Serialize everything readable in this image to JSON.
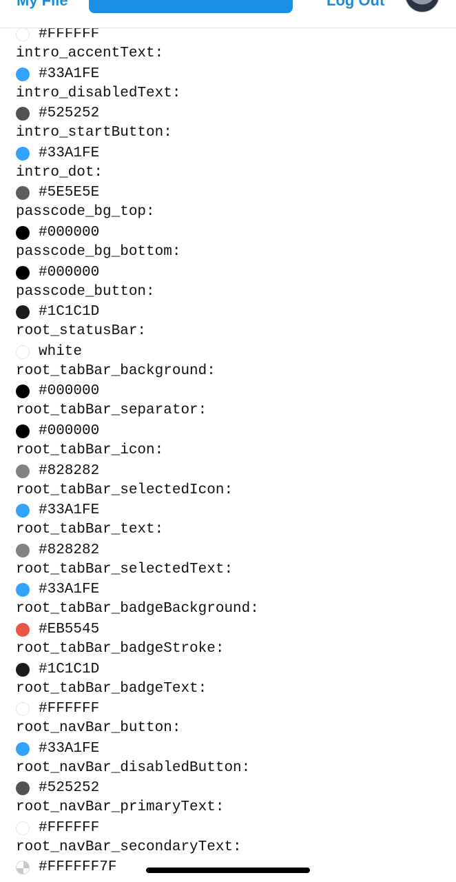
{
  "header": {
    "left_link": "My File",
    "right_link": "Log Out"
  },
  "colors": [
    {
      "value": "#FFFFFF",
      "swatch": "#FFFFFF",
      "next_name": "intro_accentText:"
    },
    {
      "value": "#33A1FE",
      "swatch": "#33A1FE",
      "next_name": "intro_disabledText:"
    },
    {
      "value": "#525252",
      "swatch": "#525252",
      "next_name": "intro_startButton:"
    },
    {
      "value": "#33A1FE",
      "swatch": "#33A1FE",
      "next_name": "intro_dot:"
    },
    {
      "value": "#5E5E5E",
      "swatch": "#5E5E5E",
      "next_name": "passcode_bg_top:"
    },
    {
      "value": "#000000",
      "swatch": "#000000",
      "next_name": "passcode_bg_bottom:"
    },
    {
      "value": "#000000",
      "swatch": "#000000",
      "next_name": "passcode_button:"
    },
    {
      "value": "#1C1C1D",
      "swatch": "#1C1C1D",
      "next_name": "root_statusBar:"
    },
    {
      "value": "white",
      "swatch": "#FFFFFF",
      "next_name": "root_tabBar_background:"
    },
    {
      "value": "#000000",
      "swatch": "#000000",
      "next_name": "root_tabBar_separator:"
    },
    {
      "value": "#000000",
      "swatch": "#000000",
      "next_name": "root_tabBar_icon:"
    },
    {
      "value": "#828282",
      "swatch": "#828282",
      "next_name": "root_tabBar_selectedIcon:"
    },
    {
      "value": "#33A1FE",
      "swatch": "#33A1FE",
      "next_name": "root_tabBar_text:"
    },
    {
      "value": "#828282",
      "swatch": "#828282",
      "next_name": "root_tabBar_selectedText:"
    },
    {
      "value": "#33A1FE",
      "swatch": "#33A1FE",
      "next_name": "root_tabBar_badgeBackground:"
    },
    {
      "value": "#EB5545",
      "swatch": "#EB5545",
      "next_name": "root_tabBar_badgeStroke:"
    },
    {
      "value": "#1C1C1D",
      "swatch": "#1C1C1D",
      "next_name": "root_tabBar_badgeText:"
    },
    {
      "value": "#FFFFFF",
      "swatch": "#FFFFFF",
      "next_name": "root_navBar_button:"
    },
    {
      "value": "#33A1FE",
      "swatch": "#33A1FE",
      "next_name": "root_navBar_disabledButton:"
    },
    {
      "value": "#525252",
      "swatch": "#525252",
      "next_name": "root_navBar_primaryText:"
    },
    {
      "value": "#FFFFFF",
      "swatch": "#FFFFFF",
      "next_name": "root_navBar_secondaryText:"
    },
    {
      "value": "#FFFFFF7F",
      "swatch": "#FFFFFF7F",
      "next_name": ""
    }
  ]
}
